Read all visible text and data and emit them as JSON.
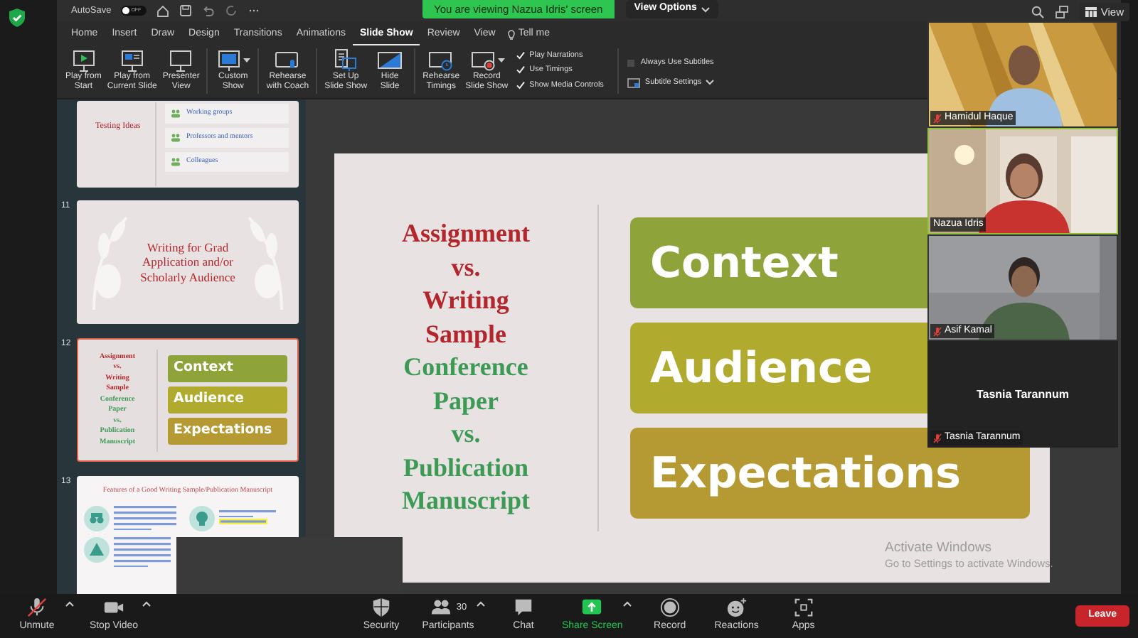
{
  "title_bar": {
    "autosave": {
      "label": "AutoSave",
      "on": false,
      "state_text": "OFF"
    }
  },
  "share_banner": {
    "text": "You are viewing Nazua Idris' screen",
    "view_options": "View Options"
  },
  "meeting_top": {
    "view": "View"
  },
  "ribbon": {
    "tabs": [
      {
        "label": "Home",
        "selected": false
      },
      {
        "label": "Insert",
        "selected": false
      },
      {
        "label": "Draw",
        "selected": false
      },
      {
        "label": "Design",
        "selected": false
      },
      {
        "label": "Transitions",
        "selected": false
      },
      {
        "label": "Animations",
        "selected": false
      },
      {
        "label": "Slide Show",
        "selected": true
      },
      {
        "label": "Review",
        "selected": false
      },
      {
        "label": "View",
        "selected": false
      }
    ],
    "tell_me": "Tell me",
    "groups": [
      [
        {
          "kind": "play",
          "lines": [
            "Play from",
            "Start"
          ]
        },
        {
          "kind": "current",
          "lines": [
            "Play from",
            "Current Slide"
          ]
        },
        {
          "kind": "presenter",
          "lines": [
            "Presenter",
            "View"
          ]
        }
      ],
      [
        {
          "kind": "custom",
          "lines": [
            "Custom",
            "Show"
          ],
          "dropdown": true
        }
      ],
      [
        {
          "kind": "coach",
          "lines": [
            "Rehearse",
            "with Coach"
          ]
        }
      ],
      [
        {
          "kind": "setup",
          "lines": [
            "Set Up",
            "Slide Show"
          ]
        },
        {
          "kind": "hide",
          "lines": [
            "Hide",
            "Slide"
          ]
        }
      ],
      [
        {
          "kind": "timings",
          "lines": [
            "Rehearse",
            "Timings"
          ]
        },
        {
          "kind": "record",
          "lines": [
            "Record",
            "Slide Show"
          ],
          "dropdown": true
        }
      ]
    ],
    "checks": [
      {
        "label": "Play Narrations",
        "checked": true
      },
      {
        "label": "Use Timings",
        "checked": true
      },
      {
        "label": "Show Media Controls",
        "checked": true
      }
    ],
    "subtitles": {
      "always": {
        "label": "Always Use Subtitles",
        "checked": false
      },
      "settings": "Subtitle Settings"
    }
  },
  "slides": [
    {
      "kind": "list",
      "selected": false,
      "title": "Testing Ideas",
      "items": [
        "Working groups",
        "Professors and mentors",
        "Colleagues"
      ]
    },
    {
      "kind": "title",
      "number": "11",
      "selected": false,
      "title": "Writing for Grad Application and/or Scholarly Audience"
    },
    {
      "kind": "compare",
      "number": "12",
      "selected": true,
      "lines": [
        {
          "text": "Assignment",
          "color": "#b3262b"
        },
        {
          "text": "vs.",
          "color": "#b3262b"
        },
        {
          "text": "Writing",
          "color": "#b3262b"
        },
        {
          "text": "Sample",
          "color": "#b3262b"
        },
        {
          "text": "Conference",
          "color": "#3c9a55"
        },
        {
          "text": "Paper",
          "color": "#3c9a55"
        },
        {
          "text": "vs.",
          "color": "#3c9a55"
        },
        {
          "text": "Publication",
          "color": "#3c9a55"
        },
        {
          "text": "Manuscript",
          "color": "#3c9a55"
        }
      ],
      "boxes": [
        {
          "text": "Context",
          "color": "#8fa33b"
        },
        {
          "text": "Audience",
          "color": "#b0ab2e"
        },
        {
          "text": "Expectations",
          "color": "#b59a33"
        }
      ]
    },
    {
      "kind": "features",
      "number": "13",
      "selected": false,
      "title": "Features of a Good Writing Sample/Publication Manuscript"
    }
  ],
  "current_slide": {
    "lines": [
      {
        "text": "Assignment",
        "color": "#b3262b"
      },
      {
        "text": "vs.",
        "color": "#b3262b"
      },
      {
        "text": "Writing",
        "color": "#b3262b"
      },
      {
        "text": "Sample",
        "color": "#b3262b"
      },
      {
        "text": "Conference",
        "color": "#3c9a55"
      },
      {
        "text": "Paper",
        "color": "#3c9a55"
      },
      {
        "text": "vs.",
        "color": "#3c9a55"
      },
      {
        "text": "Publication",
        "color": "#3c9a55"
      },
      {
        "text": "Manuscript",
        "color": "#3c9a55"
      }
    ],
    "boxes": [
      {
        "text": "Context",
        "color": "#8fa33b"
      },
      {
        "text": "Audience",
        "color": "#b0ab2e"
      },
      {
        "text": "Expectations",
        "color": "#b59a33"
      }
    ]
  },
  "activation_notice": {
    "title": "Activate Windows",
    "text": "Go to Settings to activate Windows."
  },
  "video_panel": {
    "tiles": [
      {
        "kind": "video",
        "name": "Hamidul Haque",
        "muted": true,
        "speaking": false
      },
      {
        "kind": "video",
        "name": "Nazua Idris",
        "muted": false,
        "speaking": true
      },
      {
        "kind": "video",
        "name": "Asif Kamal",
        "muted": true,
        "speaking": false
      },
      {
        "kind": "avatar",
        "display_name": "Tasnia Tarannum",
        "name": "Tasnia Tarannum",
        "muted": true,
        "speaking": false
      }
    ]
  },
  "toolbar": {
    "left": [
      {
        "kind": "mic",
        "label": "Unmute",
        "muted": true,
        "caret": true
      },
      {
        "kind": "camera",
        "label": "Stop Video",
        "caret": true
      }
    ],
    "center": [
      {
        "kind": "security",
        "label": "Security"
      },
      {
        "kind": "participants",
        "label": "Participants",
        "count": "30",
        "caret": true
      },
      {
        "kind": "chat",
        "label": "Chat"
      },
      {
        "kind": "share",
        "label": "Share Screen",
        "caret": true
      },
      {
        "kind": "record",
        "label": "Record"
      },
      {
        "kind": "reactions",
        "label": "Reactions"
      },
      {
        "kind": "apps",
        "label": "Apps"
      }
    ],
    "leave": "Leave"
  }
}
